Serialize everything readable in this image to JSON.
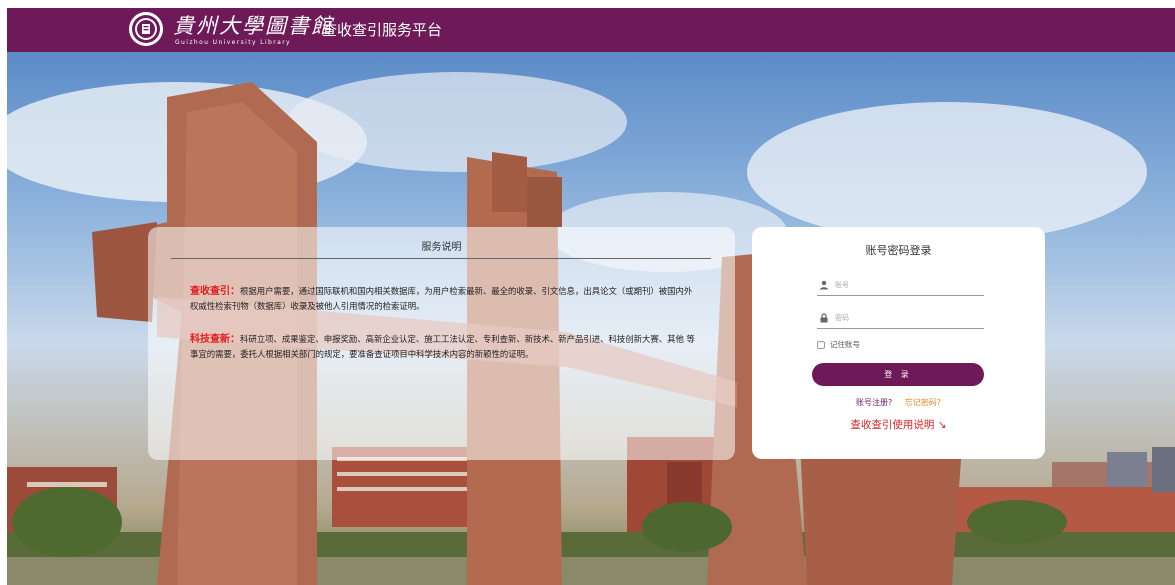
{
  "header": {
    "logo_cn": "貴州大學圖書館",
    "logo_en": "Guizhou University Library",
    "platform_title": "查收查引服务平台",
    "bar_color": "#6e1a59"
  },
  "service": {
    "title": "服务说明",
    "para1_keyword": "查收查引：",
    "para1_text": "根据用户需要，通过国际联机和国内相关数据库，为用户检索最新、最全的收录、引文信息，出具论文（或期刊）被国内外权威性检索刊物（数据库）收录及被他人引用情况的检索证明。",
    "para2_keyword": "科技查新：",
    "para2_text": "科研立项、成果鉴定、申报奖励、高新企业认定、施工工法认定、专利查新、新技术、新产品引进、科技创新大赛、其他 等事宜的需要，委托人根据相关部门的规定，要准备查证项目中科学技术内容的新颖性的证明。",
    "keyword_color": "#e31c1c"
  },
  "login": {
    "title": "账号密码登录",
    "username_placeholder": "账号",
    "password_placeholder": "密码",
    "username_icon": "user-icon",
    "password_icon": "lock-icon",
    "remember_label": "记住账号",
    "remember_checked": false,
    "submit_label": "登 录",
    "register_link": "账号注册?",
    "forgot_link": "忘记密码?",
    "guide_link": "查收查引使用说明 ↘",
    "guide_color": "#d82626",
    "forgot_color": "#e8861c"
  }
}
